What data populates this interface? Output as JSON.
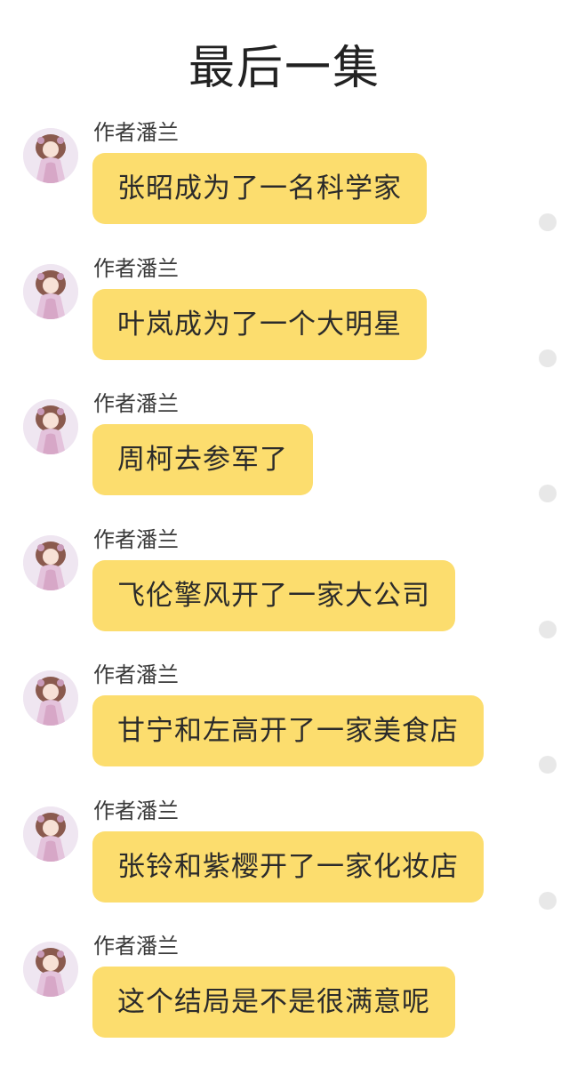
{
  "title": "最后一集",
  "messages": [
    {
      "author": "作者潘兰",
      "text": "张昭成为了一名科学家",
      "avatar_icon": "anime-girl-avatar-icon"
    },
    {
      "author": "作者潘兰",
      "text": "叶岚成为了一个大明星",
      "avatar_icon": "anime-girl-avatar-icon"
    },
    {
      "author": "作者潘兰",
      "text": "周柯去参军了",
      "avatar_icon": "anime-girl-avatar-icon"
    },
    {
      "author": "作者潘兰",
      "text": "飞伦擎风开了一家大公司",
      "avatar_icon": "anime-girl-avatar-icon"
    },
    {
      "author": "作者潘兰",
      "text": "甘宁和左高开了一家美食店",
      "avatar_icon": "anime-girl-avatar-icon"
    },
    {
      "author": "作者潘兰",
      "text": "张铃和紫樱开了一家化妆店",
      "avatar_icon": "anime-girl-avatar-icon"
    },
    {
      "author": "作者潘兰",
      "text": "这个结局是不是很满意呢",
      "avatar_icon": "anime-girl-avatar-icon"
    }
  ],
  "colors": {
    "bubble": "#fcdd6e",
    "background": "#ffffff",
    "title_text": "#222222",
    "dot": "#e8e8e8"
  }
}
